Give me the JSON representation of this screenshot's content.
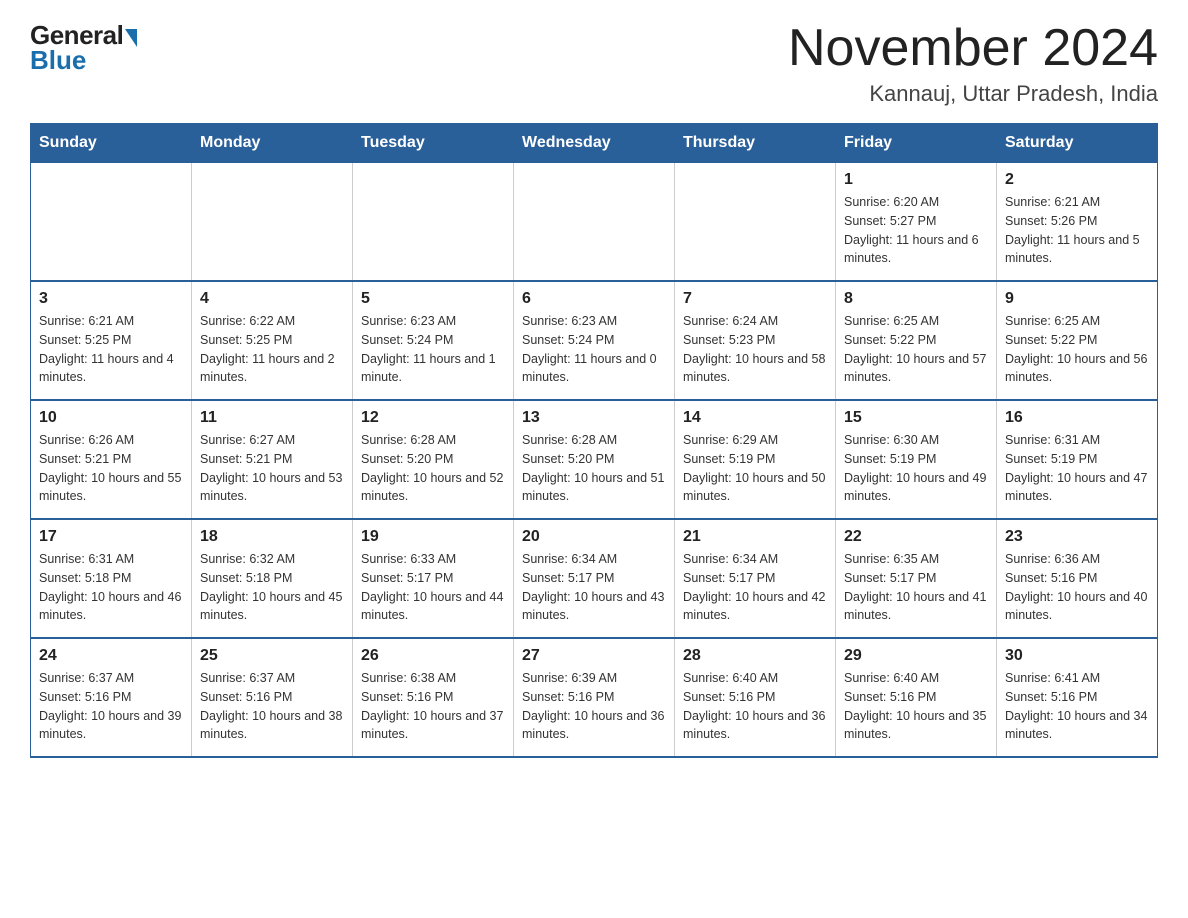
{
  "logo": {
    "general": "General",
    "blue": "Blue"
  },
  "title": {
    "month_year": "November 2024",
    "location": "Kannauj, Uttar Pradesh, India"
  },
  "weekdays": [
    "Sunday",
    "Monday",
    "Tuesday",
    "Wednesday",
    "Thursday",
    "Friday",
    "Saturday"
  ],
  "weeks": [
    [
      null,
      null,
      null,
      null,
      null,
      {
        "day": "1",
        "sunrise": "6:20 AM",
        "sunset": "5:27 PM",
        "daylight": "11 hours and 6 minutes."
      },
      {
        "day": "2",
        "sunrise": "6:21 AM",
        "sunset": "5:26 PM",
        "daylight": "11 hours and 5 minutes."
      }
    ],
    [
      {
        "day": "3",
        "sunrise": "6:21 AM",
        "sunset": "5:25 PM",
        "daylight": "11 hours and 4 minutes."
      },
      {
        "day": "4",
        "sunrise": "6:22 AM",
        "sunset": "5:25 PM",
        "daylight": "11 hours and 2 minutes."
      },
      {
        "day": "5",
        "sunrise": "6:23 AM",
        "sunset": "5:24 PM",
        "daylight": "11 hours and 1 minute."
      },
      {
        "day": "6",
        "sunrise": "6:23 AM",
        "sunset": "5:24 PM",
        "daylight": "11 hours and 0 minutes."
      },
      {
        "day": "7",
        "sunrise": "6:24 AM",
        "sunset": "5:23 PM",
        "daylight": "10 hours and 58 minutes."
      },
      {
        "day": "8",
        "sunrise": "6:25 AM",
        "sunset": "5:22 PM",
        "daylight": "10 hours and 57 minutes."
      },
      {
        "day": "9",
        "sunrise": "6:25 AM",
        "sunset": "5:22 PM",
        "daylight": "10 hours and 56 minutes."
      }
    ],
    [
      {
        "day": "10",
        "sunrise": "6:26 AM",
        "sunset": "5:21 PM",
        "daylight": "10 hours and 55 minutes."
      },
      {
        "day": "11",
        "sunrise": "6:27 AM",
        "sunset": "5:21 PM",
        "daylight": "10 hours and 53 minutes."
      },
      {
        "day": "12",
        "sunrise": "6:28 AM",
        "sunset": "5:20 PM",
        "daylight": "10 hours and 52 minutes."
      },
      {
        "day": "13",
        "sunrise": "6:28 AM",
        "sunset": "5:20 PM",
        "daylight": "10 hours and 51 minutes."
      },
      {
        "day": "14",
        "sunrise": "6:29 AM",
        "sunset": "5:19 PM",
        "daylight": "10 hours and 50 minutes."
      },
      {
        "day": "15",
        "sunrise": "6:30 AM",
        "sunset": "5:19 PM",
        "daylight": "10 hours and 49 minutes."
      },
      {
        "day": "16",
        "sunrise": "6:31 AM",
        "sunset": "5:19 PM",
        "daylight": "10 hours and 47 minutes."
      }
    ],
    [
      {
        "day": "17",
        "sunrise": "6:31 AM",
        "sunset": "5:18 PM",
        "daylight": "10 hours and 46 minutes."
      },
      {
        "day": "18",
        "sunrise": "6:32 AM",
        "sunset": "5:18 PM",
        "daylight": "10 hours and 45 minutes."
      },
      {
        "day": "19",
        "sunrise": "6:33 AM",
        "sunset": "5:17 PM",
        "daylight": "10 hours and 44 minutes."
      },
      {
        "day": "20",
        "sunrise": "6:34 AM",
        "sunset": "5:17 PM",
        "daylight": "10 hours and 43 minutes."
      },
      {
        "day": "21",
        "sunrise": "6:34 AM",
        "sunset": "5:17 PM",
        "daylight": "10 hours and 42 minutes."
      },
      {
        "day": "22",
        "sunrise": "6:35 AM",
        "sunset": "5:17 PM",
        "daylight": "10 hours and 41 minutes."
      },
      {
        "day": "23",
        "sunrise": "6:36 AM",
        "sunset": "5:16 PM",
        "daylight": "10 hours and 40 minutes."
      }
    ],
    [
      {
        "day": "24",
        "sunrise": "6:37 AM",
        "sunset": "5:16 PM",
        "daylight": "10 hours and 39 minutes."
      },
      {
        "day": "25",
        "sunrise": "6:37 AM",
        "sunset": "5:16 PM",
        "daylight": "10 hours and 38 minutes."
      },
      {
        "day": "26",
        "sunrise": "6:38 AM",
        "sunset": "5:16 PM",
        "daylight": "10 hours and 37 minutes."
      },
      {
        "day": "27",
        "sunrise": "6:39 AM",
        "sunset": "5:16 PM",
        "daylight": "10 hours and 36 minutes."
      },
      {
        "day": "28",
        "sunrise": "6:40 AM",
        "sunset": "5:16 PM",
        "daylight": "10 hours and 36 minutes."
      },
      {
        "day": "29",
        "sunrise": "6:40 AM",
        "sunset": "5:16 PM",
        "daylight": "10 hours and 35 minutes."
      },
      {
        "day": "30",
        "sunrise": "6:41 AM",
        "sunset": "5:16 PM",
        "daylight": "10 hours and 34 minutes."
      }
    ]
  ]
}
